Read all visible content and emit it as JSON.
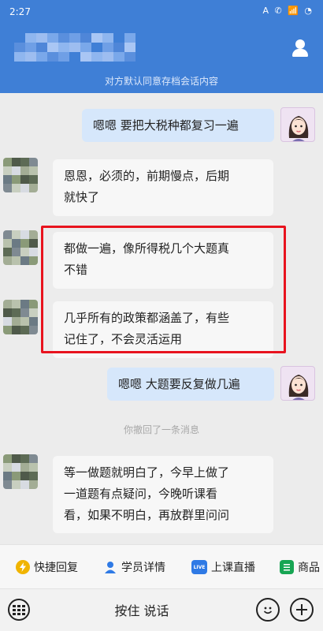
{
  "status_bar": {
    "time": "2:27",
    "icons": "A ✆ 📶 ◔"
  },
  "header": {
    "notice": "对方默认同意存档会话内容",
    "profile_icon": "person-icon"
  },
  "messages": [
    {
      "side": "right",
      "text": "嗯嗯  要把大税种都复习一遍"
    },
    {
      "side": "left",
      "lines": [
        "恩恩，必须的，前期慢点，后期",
        "就快了"
      ]
    },
    {
      "side": "left",
      "lines": [
        "都做一遍，像所得税几个大题真",
        "不错"
      ]
    },
    {
      "side": "left",
      "lines": [
        "几乎所有的政策都涵盖了，有些",
        "记住了，不会灵活运用"
      ]
    },
    {
      "side": "right",
      "text": "嗯嗯  大题要反复做几遍"
    },
    {
      "side": "system",
      "text": "你撤回了一条消息"
    },
    {
      "side": "left",
      "lines": [
        "等一做题就明白了，今早上做了",
        "一道题有点疑问，今晚听课看",
        "看，如果不明白，再放群里问问"
      ]
    }
  ],
  "quick_actions": [
    {
      "label": "快捷回复",
      "icon": "lightning-icon",
      "color": "#f0b400"
    },
    {
      "label": "学员详情",
      "icon": "person-icon",
      "color": "#2f7ae5"
    },
    {
      "label": "上课直播",
      "icon": "live-icon",
      "color": "#2f7ae5",
      "icon_text": "LIVE"
    },
    {
      "label": "商品",
      "icon": "document-icon",
      "color": "#17a553"
    }
  ],
  "input": {
    "hold_to_talk": "按住 说话"
  },
  "colors": {
    "header": "#3f7fd6",
    "highlight": "#e8131e",
    "bubble_right": "#d6e7fb"
  }
}
